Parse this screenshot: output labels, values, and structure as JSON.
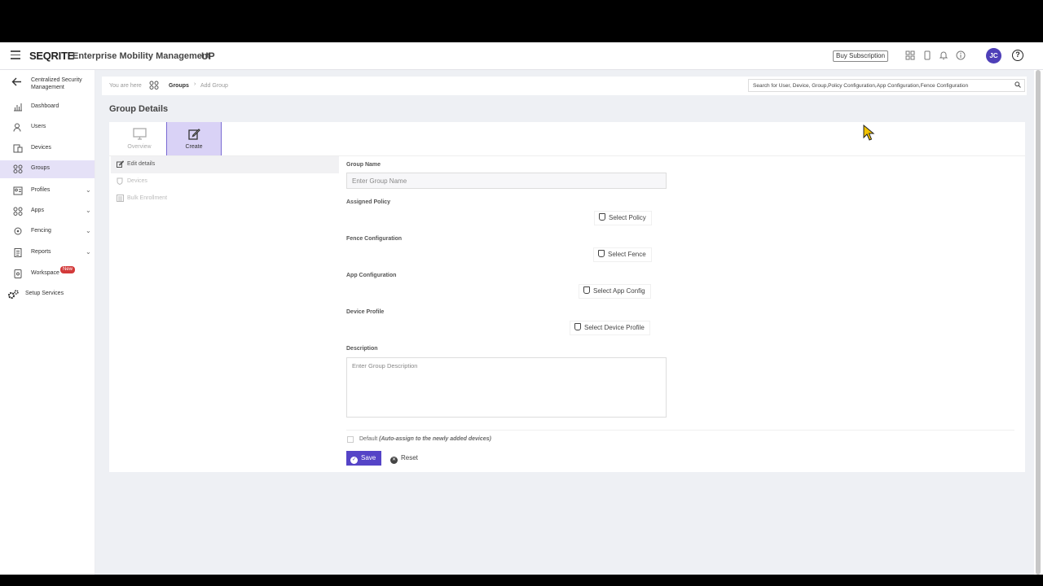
{
  "header": {
    "brand": "SEQRITE",
    "product": "Enterprise Mobility Management",
    "tenant": "UP",
    "buy_subscription": "Buy Subscription",
    "avatar_initials": "JC",
    "help_glyph": "?",
    "accent_color": "#4e3fb8"
  },
  "sidebar": {
    "back_label": "Centralized Security Management",
    "items": [
      {
        "label": "Dashboard",
        "icon": "bar-chart-icon"
      },
      {
        "label": "Users",
        "icon": "users-icon"
      },
      {
        "label": "Devices",
        "icon": "devices-icon"
      },
      {
        "label": "Groups",
        "icon": "groups-icon",
        "active": true
      },
      {
        "label": "Profiles",
        "icon": "profiles-icon"
      },
      {
        "label": "Apps",
        "icon": "apps-icon"
      },
      {
        "label": "Fencing",
        "icon": "fencing-icon"
      },
      {
        "label": "Reports",
        "icon": "reports-icon"
      },
      {
        "label": "Workspace",
        "icon": "workspace-icon",
        "badge": "New"
      },
      {
        "label": "Setup Services",
        "icon": "gears-icon"
      }
    ]
  },
  "breadcrumb": {
    "prefix": "You are here",
    "section": "Groups",
    "current": "Add Group"
  },
  "search": {
    "placeholder": "Search for User, Device, Group,Policy Configuration,App Configuration,Fence Configuration"
  },
  "page": {
    "title": "Group Details"
  },
  "tabs": [
    {
      "label": "Overview",
      "active": false
    },
    {
      "label": "Create",
      "active": true
    }
  ],
  "steps": [
    {
      "label": "Edit details",
      "active": true
    },
    {
      "label": "Devices",
      "active": false
    },
    {
      "label": "Bulk Enrollment",
      "active": false
    }
  ],
  "form": {
    "group_name_label": "Group Name",
    "group_name_placeholder": "Enter Group Name",
    "group_name_value": "",
    "assigned_policy_label": "Assigned Policy",
    "select_policy": "Select Policy",
    "fence_label": "Fence Configuration",
    "select_fence": "Select Fence",
    "app_config_label": "App Configuration",
    "select_app_config": "Select App Config",
    "device_profile_label": "Device Profile",
    "select_device_profile": "Select Device Profile",
    "description_label": "Description",
    "description_placeholder": "Enter Group Description",
    "description_value": "",
    "default_label": "Default",
    "default_hint": "(Auto-assign to the newly added devices)",
    "default_checked": false,
    "save": "Save",
    "reset": "Reset"
  }
}
